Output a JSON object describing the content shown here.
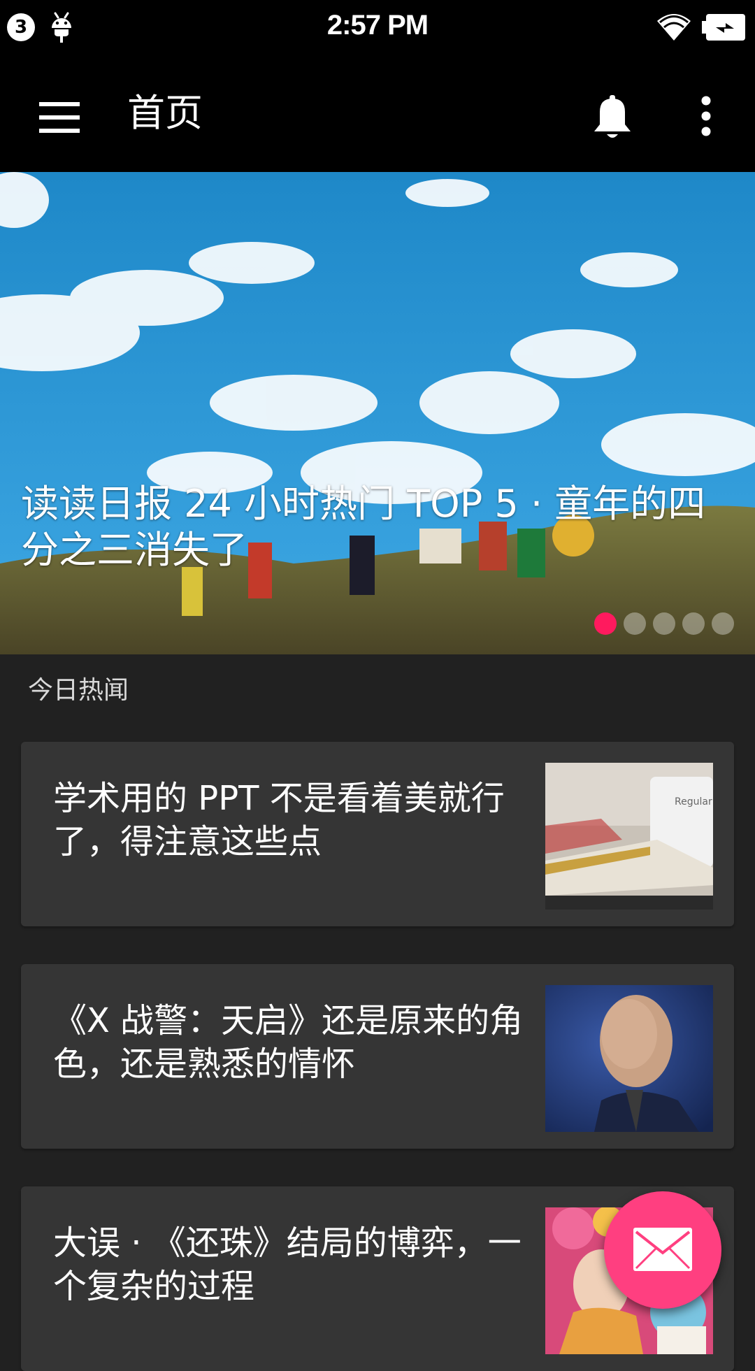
{
  "status_bar": {
    "notification_count": "3",
    "time": "2:57 PM",
    "icons": [
      "android-debug-icon",
      "wifi-icon",
      "battery-charging-icon"
    ]
  },
  "toolbar": {
    "title": "首页",
    "icons": [
      "menu-icon",
      "bell-icon",
      "more-vert-icon"
    ]
  },
  "hero": {
    "title": "读读日报 24 小时热门 TOP 5 · 童年的四分之三消失了",
    "page_count": 5,
    "active_index": 0
  },
  "section": {
    "title": "今日热闻"
  },
  "stories": [
    {
      "title": "学术用的 PPT 不是看着美就行了，得注意这些点",
      "thumb_label": "Regular Bold Black"
    },
    {
      "title": "《X 战警：天启》还是原来的角色，还是熟悉的情怀"
    },
    {
      "title": "大误 · 《还珠》结局的博弈，一个复杂的过程"
    }
  ],
  "fab": {
    "icon": "mail-icon"
  },
  "colors": {
    "toolbar_bg": "#000000",
    "page_bg": "#212121",
    "card_bg": "#353535",
    "accent": "#ff3f80",
    "dot_active": "#ff1a5e"
  }
}
